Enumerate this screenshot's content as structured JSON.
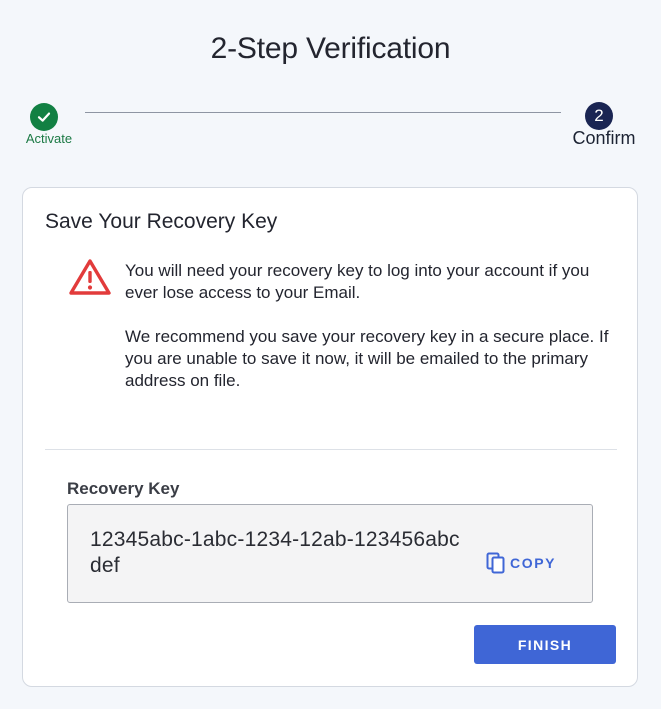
{
  "page": {
    "title": "2-Step Verification"
  },
  "stepper": {
    "steps": [
      {
        "label": "Activate",
        "state": "completed",
        "icon": "check-icon"
      },
      {
        "label": "Confirm",
        "state": "current",
        "number": "2"
      }
    ]
  },
  "card": {
    "title": "Save Your Recovery Key",
    "warning_icon": "warning-triangle-icon",
    "message_1": "You will need your recovery key to log into your account if you ever lose access to your Email.",
    "message_2": "We recommend you save your recovery key in a secure place. If you are unable to save it now, it will be emailed to the primary address on file.",
    "recovery_key_label": "Recovery Key",
    "recovery_key_value": "12345abc-1abc-1234-12ab-123456abcdef",
    "copy_label": "COPY",
    "copy_icon": "copy-icon",
    "finish_label": "FINISH"
  },
  "colors": {
    "page_background": "#f4f7fb",
    "accent": "#3f66d6",
    "success": "#128043",
    "current_step": "#1a2553",
    "warning": "#e23b3b"
  }
}
